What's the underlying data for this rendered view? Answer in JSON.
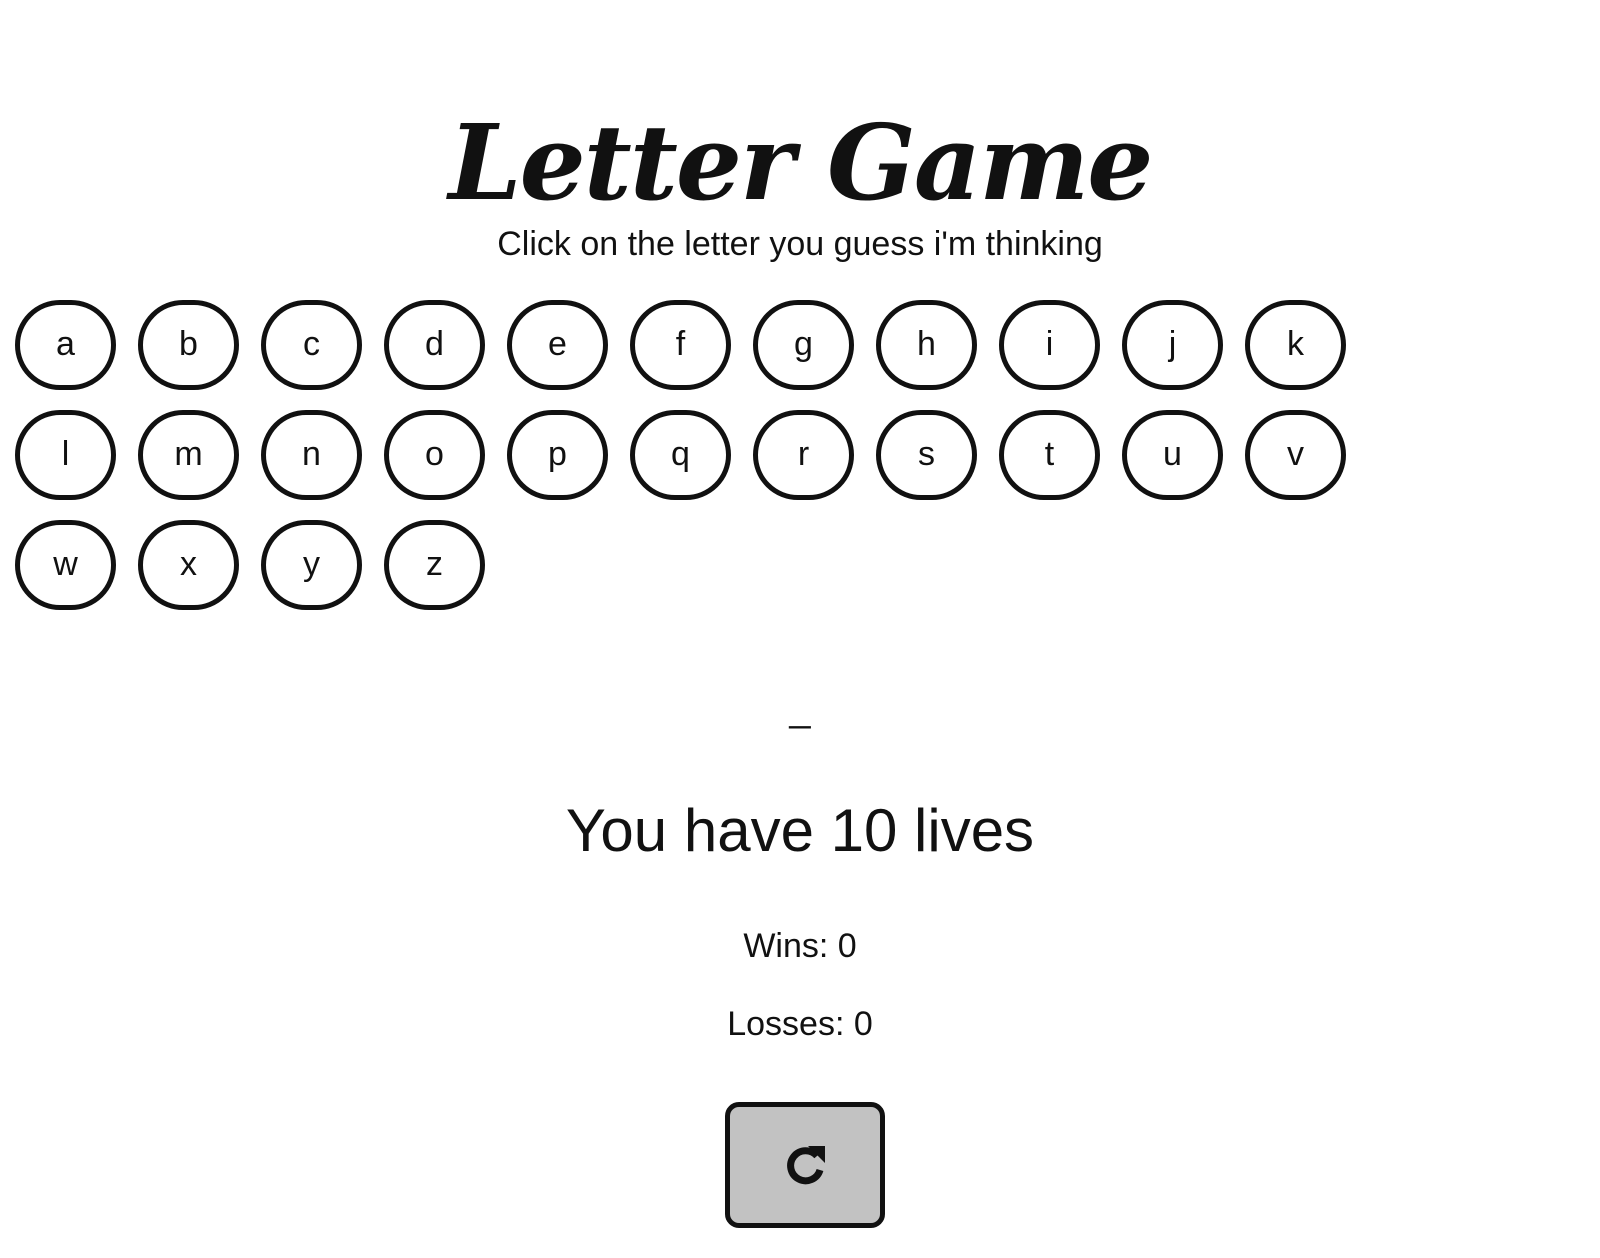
{
  "title": "Letter Game",
  "instruction": "Click on the letter you guess i'm thinking",
  "letters": [
    "a",
    "b",
    "c",
    "d",
    "e",
    "f",
    "g",
    "h",
    "i",
    "j",
    "k",
    "l",
    "m",
    "n",
    "o",
    "p",
    "q",
    "r",
    "s",
    "t",
    "u",
    "v",
    "w",
    "x",
    "y",
    "z"
  ],
  "word_display": "_",
  "lives_text": "You have 10 lives",
  "wins_text": "Wins: 0",
  "losses_text": "Losses: 0",
  "reset_button": {
    "icon": "redo-icon"
  }
}
